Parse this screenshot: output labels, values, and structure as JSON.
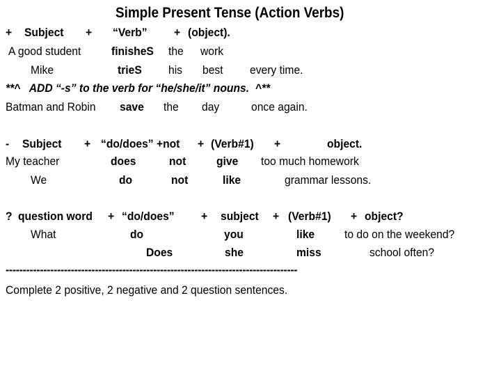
{
  "title": "Simple Present Tense (Action Verbs)",
  "positive": {
    "formula": [
      "+",
      "Subject",
      "+",
      "“Verb”",
      "+",
      "(object)."
    ],
    "example1": [
      "A good student",
      "finisheS",
      "the",
      "work"
    ],
    "example2": [
      "Mike",
      "trieS",
      "his",
      "best",
      "every time."
    ],
    "note": "**^   ADD “-s” to the verb for “he/she/it” nouns.  ^**",
    "example3": [
      "Batman and Robin",
      "save",
      "the",
      "day",
      "once again."
    ]
  },
  "negative": {
    "formula": [
      "-",
      "Subject",
      "+",
      "“do/does” +not",
      "+",
      "(Verb#1)",
      "+",
      "object."
    ],
    "example1": [
      "My teacher",
      "does",
      "not",
      "give",
      "too much homework"
    ],
    "example2": [
      "We",
      "do",
      "not",
      "like",
      "grammar lessons."
    ]
  },
  "question": {
    "formula": [
      "?",
      "question word",
      "+",
      "“do/does”",
      "+",
      "subject",
      "+",
      "(Verb#1)",
      "+",
      "object?"
    ],
    "example1": [
      "What",
      "do",
      "you",
      "like",
      "to do on the weekend?"
    ],
    "example2": [
      "Does",
      "she",
      "miss",
      "school often?"
    ]
  },
  "divider": "-------------------------------------------------------------------------------------",
  "instruction": "Complete 2 positive, 2 negative and 2 question sentences."
}
